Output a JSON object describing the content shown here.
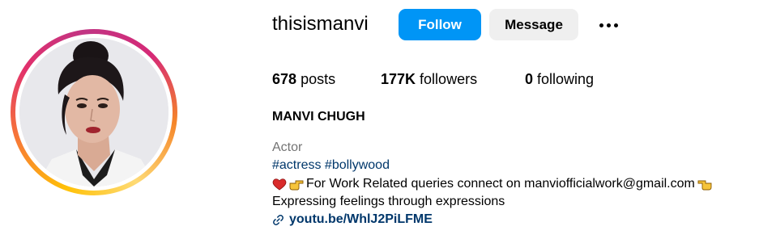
{
  "profile": {
    "username": "thisismanvi",
    "follow_label": "Follow",
    "message_label": "Message",
    "more_icon": "more-options-icon",
    "avatar_alt": "profile-picture"
  },
  "stats": {
    "posts_count": "678",
    "posts_label": "posts",
    "followers_count": "177K",
    "followers_label": "followers",
    "following_count": "0",
    "following_label": "following"
  },
  "bio": {
    "full_name": "MANVI CHUGH",
    "category": "Actor",
    "hashtags": [
      "#actress",
      "#bollywood"
    ],
    "line1_text": "For Work Related queries connect on manviofficialwork@gmail.com",
    "line2_text": "Expressing feelings through expressions",
    "link_text": "youtu.be/WhlJ2PiLFME"
  },
  "colors": {
    "follow_button": "#0095f6",
    "message_button": "#efefef",
    "hashtag_link": "#00376b",
    "category_text": "#737373"
  }
}
